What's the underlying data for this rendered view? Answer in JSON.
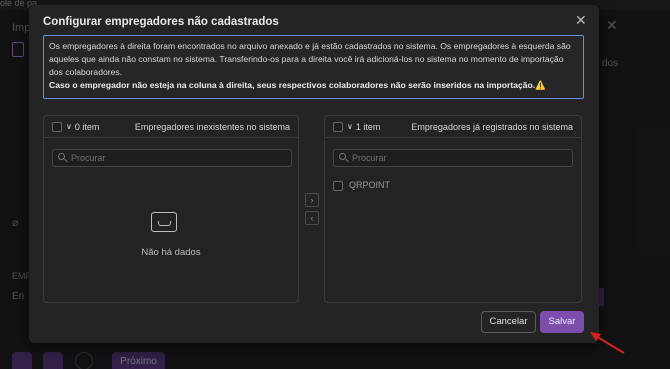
{
  "background": {
    "top_text": "ole de pa",
    "title": "Imp",
    "right_text": "dos",
    "emp_label": "EMP",
    "emp_input": "En",
    "next_label": "Próximo"
  },
  "modal": {
    "title": "Configurar empregadores não cadastrados",
    "close_glyph": "✕",
    "info_text": "Os empregadores à direita foram encontrados no arquivo anexado e já estão cadastrados no sistema. Os empregadores à esquerda são aqueles que ainda não constam no sistema. Transferindo-os para a direita você irá adicioná-los no sistema no momento de importação dos colaboradores.",
    "info_warning": "Caso o empregador não esteja na coluna à direita, seus respectivos colaboradores não serão inseridos na importação.⚠️",
    "left": {
      "count": "0 item",
      "title": "Empregadores inexistentes no sistema",
      "search_placeholder": "Procurar",
      "empty_text": "Não há dados"
    },
    "right": {
      "count": "1 item",
      "title": "Empregadores já registrados no sistema",
      "search_placeholder": "Procurar",
      "items": [
        "QRPOINT"
      ]
    },
    "move_right": "›",
    "move_left": "‹",
    "cancel_label": "Cancelar",
    "save_label": "Salvar"
  },
  "colors": {
    "accent": "#7c4dab",
    "info_border": "#6a8fd0",
    "annotation_arrow": "#d8201c"
  }
}
